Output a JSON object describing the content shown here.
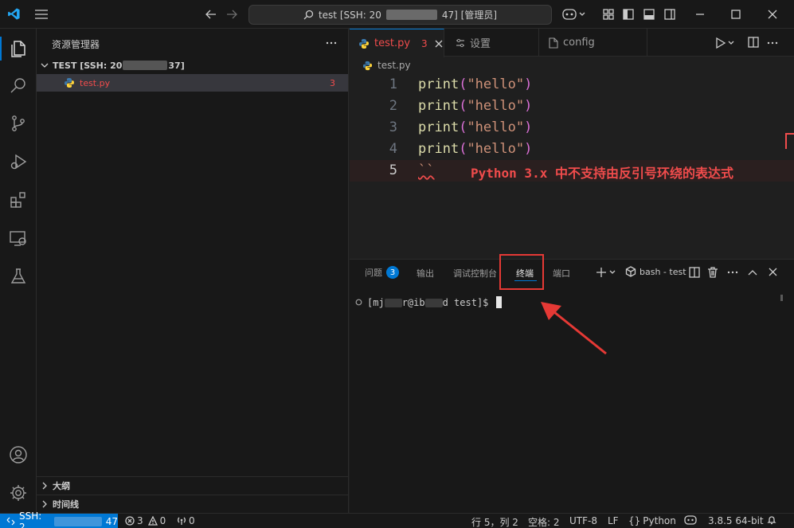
{
  "titlebar": {
    "search_text_prefix": "test [SSH: 20",
    "search_text_suffix": "47] [管理员]"
  },
  "sidebar": {
    "header": "资源管理器",
    "folder": {
      "label_prefix": "TEST [SSH: 20",
      "label_suffix": "37]"
    },
    "files": [
      {
        "name": "test.py",
        "problems": "3"
      }
    ],
    "sections": [
      {
        "label": "大纲"
      },
      {
        "label": "时间线"
      }
    ]
  },
  "editor": {
    "tabs": [
      {
        "label": "test.py",
        "badge": "3"
      },
      {
        "label": "设置"
      },
      {
        "label": "config"
      }
    ],
    "breadcrumb": "test.py",
    "lines": [
      {
        "number": "1",
        "func": "print",
        "open": "(",
        "arg": "\"hello\"",
        "close": ")"
      },
      {
        "number": "2",
        "func": "print",
        "open": "(",
        "arg": "\"hello\"",
        "close": ")"
      },
      {
        "number": "3",
        "func": "print",
        "open": "(",
        "arg": "\"hello\"",
        "close": ")"
      },
      {
        "number": "4",
        "func": "print",
        "open": "(",
        "arg": "\"hello\"",
        "close": ")"
      },
      {
        "number": "5",
        "code": "``",
        "error": "Python 3.x 中不支持由反引号环绕的表达式"
      }
    ]
  },
  "panel": {
    "tabs": [
      {
        "label": "问题",
        "badge": "3"
      },
      {
        "label": "输出"
      },
      {
        "label": "调试控制台"
      },
      {
        "label": "终端"
      },
      {
        "label": "端口"
      }
    ],
    "terminal_name": "bash - test",
    "terminal": {
      "part1": "[mj",
      "part2": "r@ib",
      "part3": "d test]$"
    }
  },
  "statusbar": {
    "remote_prefix": "SSH: 2",
    "remote_suffix": "47",
    "errors": "3",
    "warnings": "0",
    "ports": "0",
    "position": "行 5，列 2",
    "spaces": "空格: 2",
    "encoding": "UTF-8",
    "eol": "LF",
    "language": "Python",
    "interpreter": "3.8.5 64-bit"
  },
  "colors": {
    "accent": "#0078d4",
    "error": "#f14c4c",
    "annotation": "#e53935"
  }
}
